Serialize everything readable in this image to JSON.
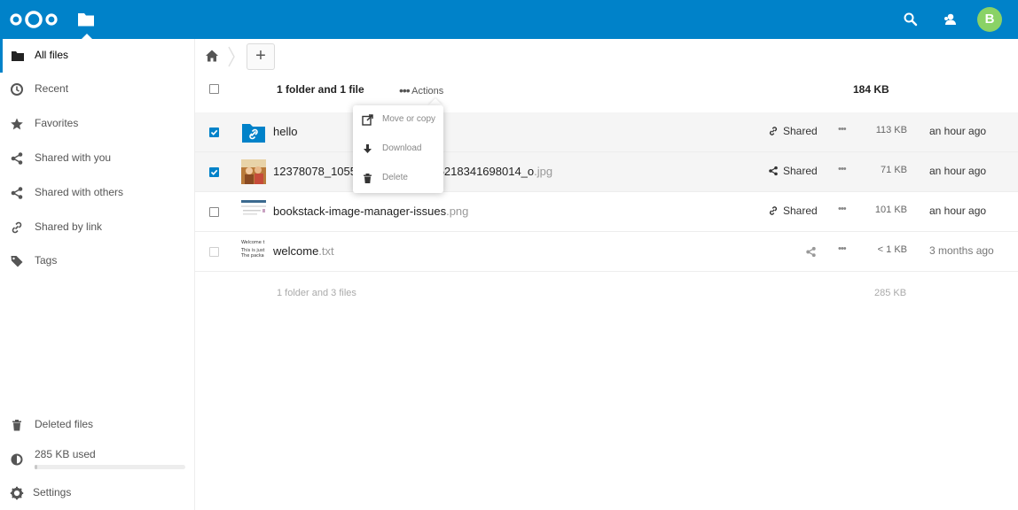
{
  "header": {
    "avatar_initial": "B",
    "accent_color": "#0082c9"
  },
  "sidebar": {
    "items": [
      {
        "label": "All files",
        "icon": "folder-icon",
        "active": true
      },
      {
        "label": "Recent",
        "icon": "clock-icon"
      },
      {
        "label": "Favorites",
        "icon": "star-icon"
      },
      {
        "label": "Shared with you",
        "icon": "share-icon"
      },
      {
        "label": "Shared with others",
        "icon": "share-icon"
      },
      {
        "label": "Shared by link",
        "icon": "link-icon"
      },
      {
        "label": "Tags",
        "icon": "tag-icon"
      }
    ],
    "deleted_files": "Deleted files",
    "quota_label": "285 KB used",
    "quota_fraction": 0.01,
    "settings": "Settings"
  },
  "filelist": {
    "selection_summary": "1 folder and 1 file",
    "actions_label": "Actions",
    "selection_size": "184 KB",
    "rows": [
      {
        "name": "hello",
        "ext": "",
        "shared": "Shared",
        "size": "113 KB",
        "date": "an hour ago",
        "checked": true
      },
      {
        "name": "12378078_10551",
        "name_tail": "495218341698014_o",
        "ext": ".jpg",
        "shared": "Shared",
        "size": "71 KB",
        "date": "an hour ago",
        "checked": true
      },
      {
        "name": "bookstack-image-manager-issues",
        "ext": ".png",
        "shared": "Shared",
        "size": "101 KB",
        "date": "an hour ago",
        "checked": false
      },
      {
        "name": "welcome",
        "ext": ".txt",
        "shared": "",
        "size": "< 1 KB",
        "date": "3 months ago",
        "checked": false,
        "thumb_text": [
          "Welcome t",
          "This is just",
          "The packa"
        ]
      }
    ],
    "footer_summary": "1 folder and 3 files",
    "footer_size": "285 KB"
  },
  "actions_menu": {
    "items": [
      "Move or copy",
      "Download",
      "Delete"
    ]
  }
}
